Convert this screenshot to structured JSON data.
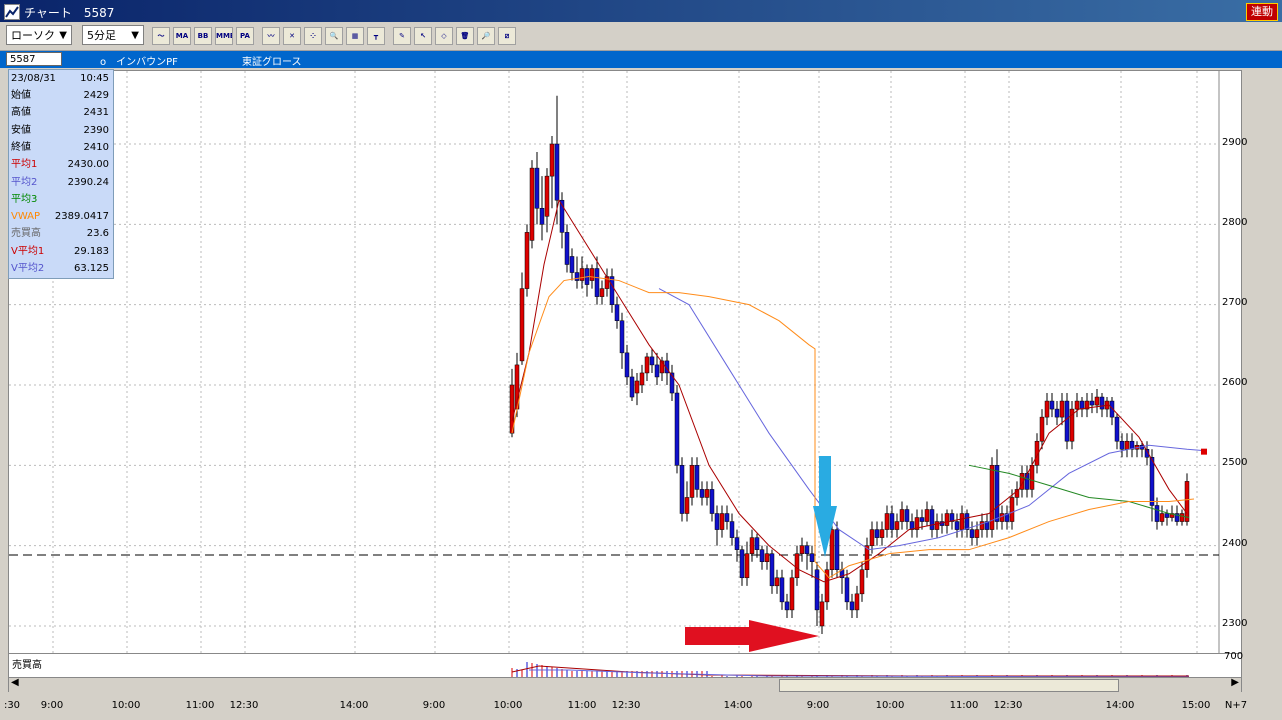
{
  "titlebar": {
    "title": "チャート　5587",
    "link_button": "連動"
  },
  "toolbar": {
    "type_select": "ローソク",
    "period_select": "5分足",
    "tools": [
      {
        "name": "line-chart-icon",
        "label": "〜"
      },
      {
        "name": "ma-icon",
        "label": "MA"
      },
      {
        "name": "bb-icon",
        "label": "BB"
      },
      {
        "name": "mme-icon",
        "label": "MME"
      },
      {
        "name": "pa-icon",
        "label": "PA"
      },
      {
        "name": "wave-icon",
        "label": "〰"
      },
      {
        "name": "pattern-icon",
        "label": "✕"
      },
      {
        "name": "scatter-icon",
        "label": "⁘"
      },
      {
        "name": "zoom-icon",
        "label": "🔍"
      },
      {
        "name": "calc-icon",
        "label": "▦"
      },
      {
        "name": "marker-icon",
        "label": "┳"
      },
      {
        "name": "pen-icon",
        "label": "✎"
      },
      {
        "name": "cursor-icon",
        "label": "↖"
      },
      {
        "name": "eraser-icon",
        "label": "◇"
      },
      {
        "name": "trash-icon",
        "label": "🗑"
      },
      {
        "name": "search-icon",
        "label": "🔎"
      },
      {
        "name": "compare-icon",
        "label": "⧄"
      }
    ]
  },
  "infobar": {
    "code": "5587",
    "name": "o　インバウンPF",
    "market": "東証グロース"
  },
  "info_panel": {
    "date": "23/08/31",
    "time": "10:45",
    "rows": [
      {
        "label": "始値",
        "value": "2429",
        "color": "#000000"
      },
      {
        "label": "高値",
        "value": "2431",
        "color": "#000000"
      },
      {
        "label": "安値",
        "value": "2390",
        "color": "#000000"
      },
      {
        "label": "終値",
        "value": "2410",
        "color": "#000000"
      },
      {
        "label": "平均1",
        "value": "2430.00",
        "color": "#cc0000"
      },
      {
        "label": "平均2",
        "value": "2390.24",
        "color": "#5555cc"
      },
      {
        "label": "平均3",
        "value": "",
        "color": "#008800"
      },
      {
        "label": "VWAP",
        "value": "2389.0417",
        "color": "#ff8800"
      },
      {
        "label": "売買高",
        "value": "23.6",
        "color": "#666666"
      },
      {
        "label": "V平均1",
        "value": "29.183",
        "color": "#cc0000"
      },
      {
        "label": "V平均2",
        "value": "63.125",
        "color": "#5555cc"
      }
    ]
  },
  "y_labels": [
    "2900",
    "2800",
    "2700",
    "2600",
    "2500",
    "2400",
    "2300"
  ],
  "volume_label": "売買高",
  "volume_axis": "700",
  "x_labels": [
    ":30",
    "9:00",
    "10:00",
    "11:00",
    "12:30",
    "14:00",
    "9:00",
    "10:00",
    "11:00",
    "12:30",
    "14:00",
    "9:00",
    "10:00",
    "11:00",
    "12:30",
    "14:00",
    "15:00",
    "N+7"
  ],
  "colors": {
    "up": "#dd0000",
    "down": "#1010cc",
    "ma1": "#aa0000",
    "ma2": "#6666dd",
    "ma3": "#228822",
    "vwap": "#ff8c1a",
    "arrow_red": "#e01020",
    "arrow_blue": "#29abe2"
  }
}
